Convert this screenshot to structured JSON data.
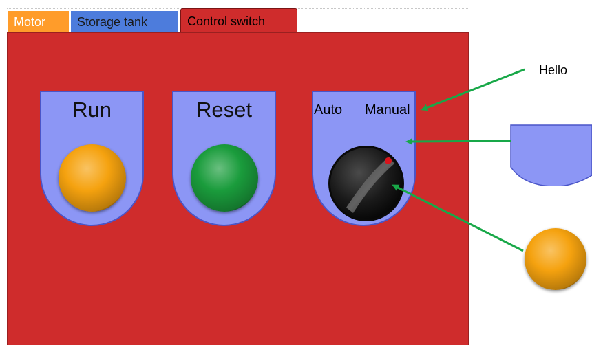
{
  "tabs": [
    {
      "label": "Motor",
      "color": "#ff9c2a"
    },
    {
      "label": "Storage tank",
      "color": "#4d7cdc"
    },
    {
      "label": "Control switch",
      "color": "#cf2c2c",
      "active": true
    }
  ],
  "panel": {
    "background": "#cf2c2c",
    "plate_color": "#8c96f5",
    "devices": [
      {
        "name": "run",
        "label": "Run",
        "light_icon": "orange-button",
        "light_color": "#f5a20f"
      },
      {
        "name": "reset",
        "label": "Reset",
        "light_icon": "green-button",
        "light_color": "#1a9c3c"
      },
      {
        "name": "mode",
        "left_label": "Auto",
        "right_label": "Manual",
        "knob_icon": "black-rotary-knob",
        "indicator_color": "#d8141c"
      }
    ]
  },
  "annotation": {
    "label": "Hello",
    "arrow_color": "#18a848"
  },
  "previews": {
    "plate_icon": "blue-plate-shape",
    "button_icon": "orange-button"
  }
}
